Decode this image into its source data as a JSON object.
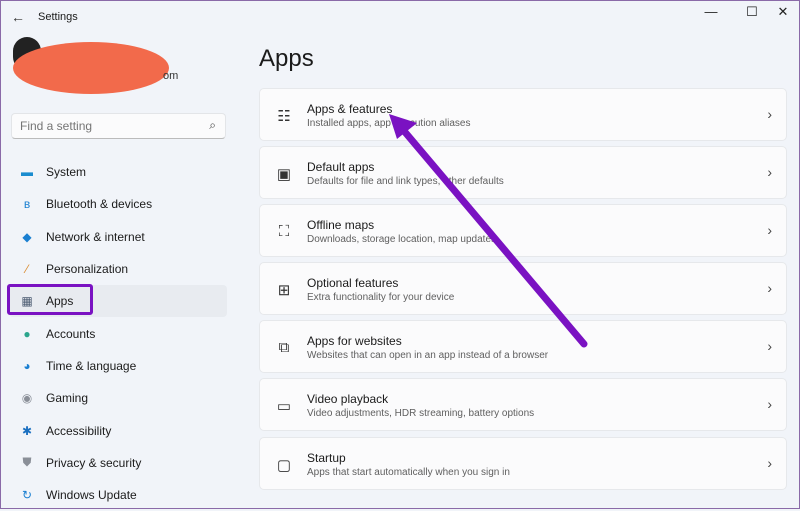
{
  "window": {
    "title": "Settings",
    "back_icon": "back-arrow-icon",
    "minimize": "—",
    "maximize": "☐",
    "close": "✕"
  },
  "account": {
    "email_suffix": "om"
  },
  "search": {
    "placeholder": "Find a setting"
  },
  "sidebar": {
    "items": [
      {
        "label": "System",
        "icon": "▬",
        "color": "#1a8ccf"
      },
      {
        "label": "Bluetooth & devices",
        "icon": "ʙ",
        "color": "#1a7fd1"
      },
      {
        "label": "Network & internet",
        "icon": "◆",
        "color": "#1a7fd1"
      },
      {
        "label": "Personalization",
        "icon": "⁄",
        "color": "#d9882b"
      },
      {
        "label": "Apps",
        "icon": "▦",
        "color": "#4a5a70"
      },
      {
        "label": "Accounts",
        "icon": "●",
        "color": "#2ba58d"
      },
      {
        "label": "Time & language",
        "icon": "◕",
        "color": "#1a7fd1"
      },
      {
        "label": "Gaming",
        "icon": "◉",
        "color": "#8a8f98"
      },
      {
        "label": "Accessibility",
        "icon": "✱",
        "color": "#1a6fc0"
      },
      {
        "label": "Privacy & security",
        "icon": "⛊",
        "color": "#8a8f98"
      },
      {
        "label": "Windows Update",
        "icon": "↻",
        "color": "#1a7fd1"
      }
    ],
    "selected": "Apps"
  },
  "main": {
    "heading": "Apps",
    "cards": [
      {
        "title": "Apps & features",
        "subtitle": "Installed apps, app execution aliases",
        "icon": "☷"
      },
      {
        "title": "Default apps",
        "subtitle": "Defaults for file and link types, other defaults",
        "icon": "▣"
      },
      {
        "title": "Offline maps",
        "subtitle": "Downloads, storage location, map updates",
        "icon": "⛶"
      },
      {
        "title": "Optional features",
        "subtitle": "Extra functionality for your device",
        "icon": "⊞"
      },
      {
        "title": "Apps for websites",
        "subtitle": "Websites that can open in an app instead of a browser",
        "icon": "⧉"
      },
      {
        "title": "Video playback",
        "subtitle": "Video adjustments, HDR streaming, battery options",
        "icon": "▭"
      },
      {
        "title": "Startup",
        "subtitle": "Apps that start automatically when you sign in",
        "icon": "▢"
      }
    ],
    "chevron": "›"
  },
  "annotation": {
    "arrow_color": "#7a12c2"
  }
}
